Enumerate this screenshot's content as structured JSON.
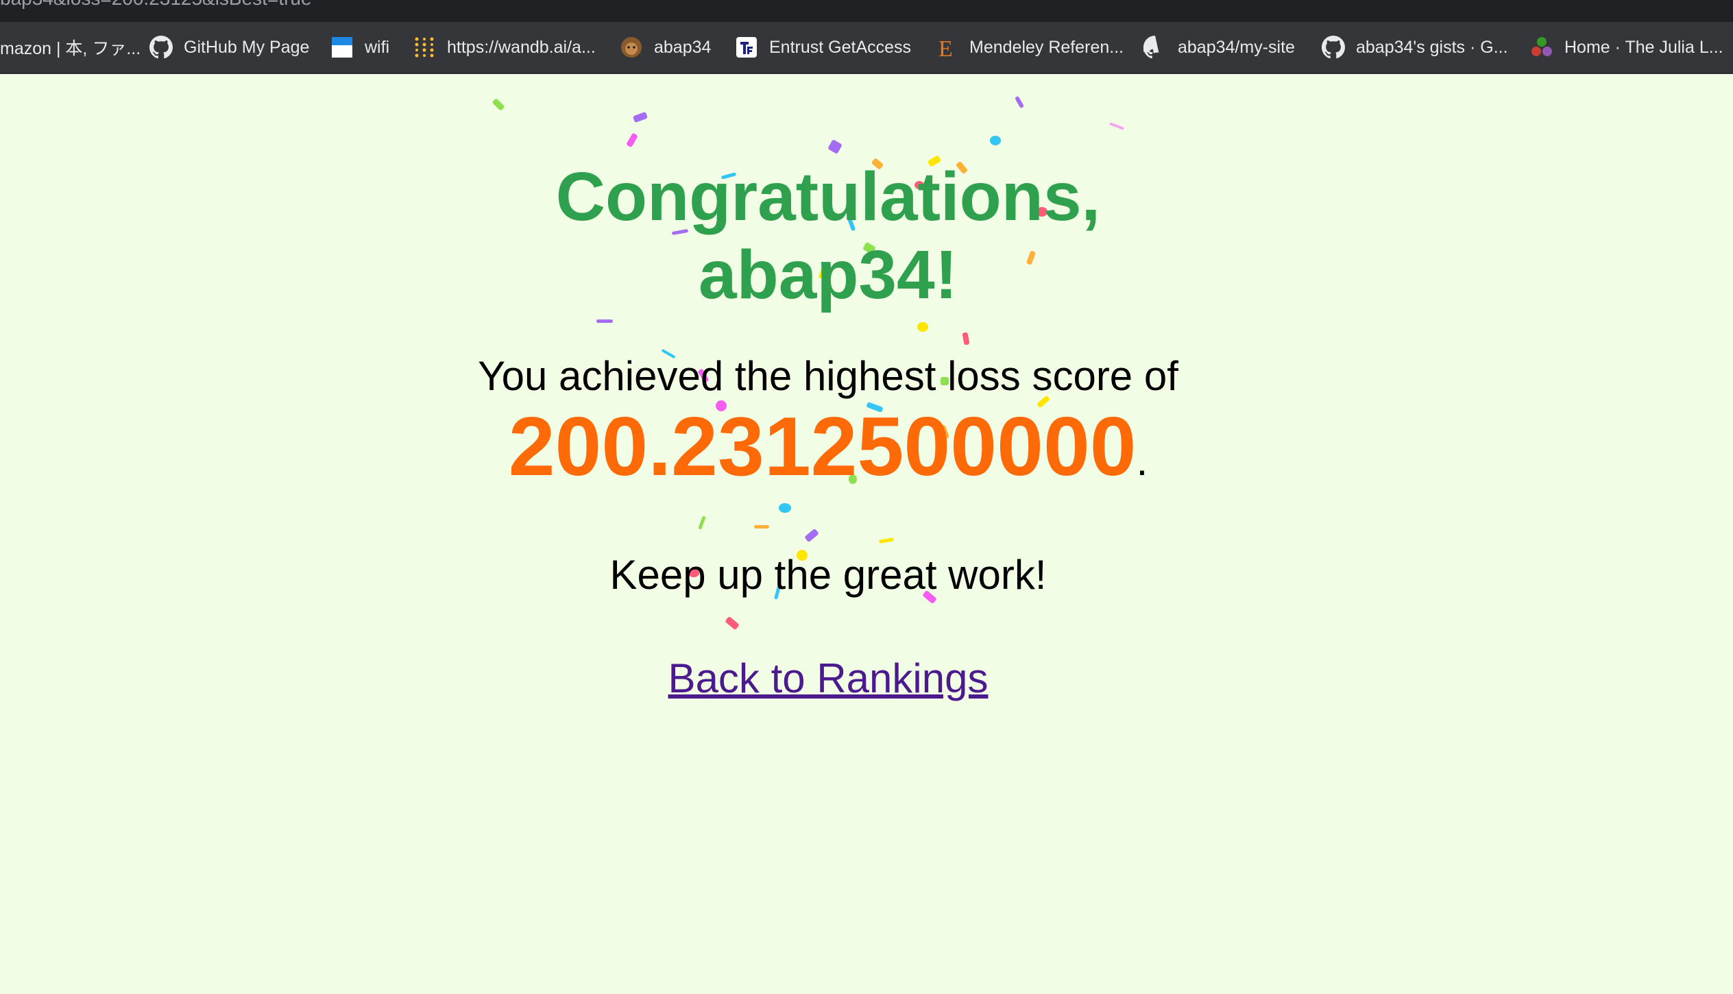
{
  "browser": {
    "url_text": "bap34&loss=200.23125&isBest=true",
    "bookmarks": [
      {
        "label": "mazon | 本, ファ...",
        "icon": "none"
      },
      {
        "label": "GitHub My Page",
        "icon": "github-icon"
      },
      {
        "label": "wifi",
        "icon": "wifi-page-icon"
      },
      {
        "label": "https://wandb.ai/a...",
        "icon": "wandb-icon"
      },
      {
        "label": "abap34",
        "icon": "avatar-icon"
      },
      {
        "label": "Entrust GetAccess",
        "icon": "entrust-icon"
      },
      {
        "label": "Mendeley Referen...",
        "icon": "mendeley-icon"
      },
      {
        "label": "abap34/my-site",
        "icon": "github-icon"
      },
      {
        "label": "abap34's gists · G...",
        "icon": "github-icon"
      },
      {
        "label": "Home · The Julia L...",
        "icon": "julia-icon"
      }
    ]
  },
  "page": {
    "title_line1": "Congratulations,",
    "title_line2": "abap34!",
    "achieved_text": "You achieved the highest loss score of",
    "score": "200.2312500000",
    "score_suffix": ".",
    "keep_text": "Keep up the great work!",
    "back_link": "Back to Rankings"
  },
  "colors": {
    "background": "#f1fde4",
    "title": "#2fa04e",
    "score": "#ff6a09",
    "link": "#4b1a8c"
  }
}
